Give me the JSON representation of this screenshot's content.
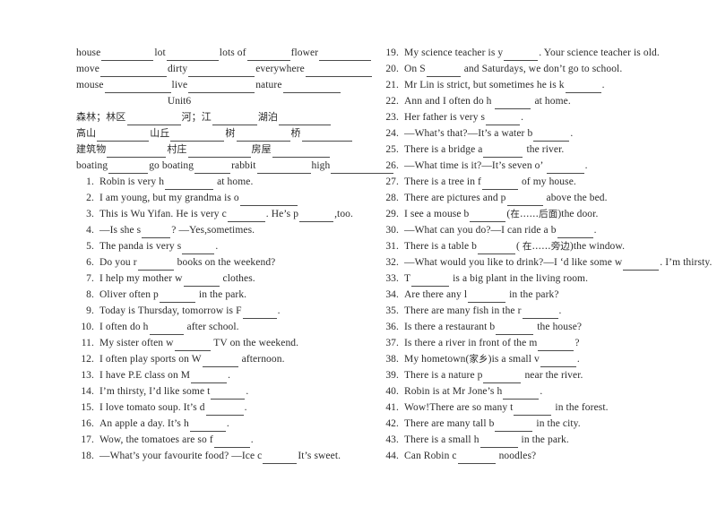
{
  "document": {
    "title": "Unit6 English Vocabulary and Fill-in-the-Blank Worksheet",
    "unit_heading": "Unit6"
  },
  "vocab_rows": [
    {
      "id": "vocab-row-1",
      "items": [
        {
          "word": "house",
          "blank": 58
        },
        {
          "word": "lot",
          "blank": 58
        },
        {
          "word": "lots of",
          "blank": 48
        },
        {
          "word": "flower",
          "blank": 58
        }
      ]
    },
    {
      "id": "vocab-row-2",
      "items": [
        {
          "word": "move",
          "blank": 74
        },
        {
          "word": "dirty",
          "blank": 74
        },
        {
          "word": "everywhere",
          "blank": 74
        }
      ]
    },
    {
      "id": "vocab-row-3",
      "items": [
        {
          "word": "mouse",
          "blank": 74
        },
        {
          "word": "live",
          "blank": 74
        },
        {
          "word": "nature",
          "blank": 64
        }
      ]
    },
    {
      "id": "vocab-row-4",
      "chinese": true,
      "items": [
        {
          "word": "森林；林区",
          "blank": 60
        },
        {
          "word": "河；江",
          "blank": 50
        },
        {
          "word": "湖泊",
          "blank": 58
        }
      ]
    },
    {
      "id": "vocab-row-5",
      "chinese": true,
      "items": [
        {
          "word": "高山",
          "blank": 58
        },
        {
          "word": "山丘",
          "blank": 60
        },
        {
          "word": "树",
          "blank": 60
        },
        {
          "word": "桥",
          "blank": 56
        }
      ]
    },
    {
      "id": "vocab-row-6",
      "chinese": true,
      "items": [
        {
          "word": "建筑物",
          "blank": 66
        },
        {
          "word": "村庄",
          "blank": 70
        },
        {
          "word": "房屋",
          "blank": 64
        }
      ]
    },
    {
      "id": "vocab-row-7",
      "items": [
        {
          "word": "boating",
          "blank": 44
        },
        {
          "word": "go boating",
          "blank": 40
        },
        {
          "word": "rabbit",
          "blank": 60
        },
        {
          "word": "high",
          "blank": 70
        }
      ]
    }
  ],
  "questions_left": [
    {
      "num": "1.",
      "pre": "Robin is very h",
      "blank": 54,
      "post": " at home."
    },
    {
      "num": "2.",
      "pre": "I am young, but my grandma is o",
      "blank": 64,
      "post": ""
    },
    {
      "num": "3.",
      "pre": "This is Wu Yifan. He is very c",
      "blank": 42,
      "post": ". He’s p",
      "blank2": 38,
      "post2": ",too."
    },
    {
      "num": "4.",
      "pre": "—Is she s",
      "blank": 32,
      "post": "?   —Yes,sometimes."
    },
    {
      "num": "5.",
      "pre": "The panda is very    s",
      "blank": 36,
      "post": "."
    },
    {
      "num": "6.",
      "pre": "Do you r",
      "blank": 40,
      "post": " books on the weekend?"
    },
    {
      "num": "7.",
      "pre": "I help my mother w",
      "blank": 40,
      "post": " clothes."
    },
    {
      "num": "8.",
      "pre": "Oliver often p",
      "blank": 40,
      "post": " in the park."
    },
    {
      "num": "9.",
      "pre": "Today is Thursday, tomorrow is F",
      "blank": 38,
      "post": "."
    },
    {
      "num": "10.",
      "pre": "I often do h",
      "blank": 38,
      "post": " after school."
    },
    {
      "num": "11.",
      "pre": "My sister often w",
      "blank": 40,
      "post": " TV on the weekend."
    },
    {
      "num": "12.",
      "pre": "I often play sports on W",
      "blank": 40,
      "post": " afternoon."
    },
    {
      "num": "13.",
      "pre": "I have P.E class on M",
      "blank": 40,
      "post": "."
    },
    {
      "num": "14.",
      "pre": "I’m thirsty, I’d like some t",
      "blank": 38,
      "post": "."
    },
    {
      "num": "15.",
      "pre": "I love tomato soup. It’s d",
      "blank": 42,
      "post": "."
    },
    {
      "num": "16.",
      "pre": " An apple a day. It’s h",
      "blank": 40,
      "post": "."
    },
    {
      "num": "17.",
      "pre": "Wow, the tomatoes are so f",
      "blank": 40,
      "post": "."
    },
    {
      "num": "18.",
      "pre": "—What’s your favourite food?   —Ice c",
      "blank": 38,
      "post": "It’s sweet."
    }
  ],
  "questions_right": [
    {
      "num": "19.",
      "pre": "My science teacher is y",
      "blank": 38,
      "post": ". Your science teacher is old."
    },
    {
      "num": "20.",
      "pre": "On S",
      "blank": 38,
      "post": " and Saturdays, we don’t go to school."
    },
    {
      "num": "21.",
      "pre": "Mr Lin is strict, but sometimes he is k",
      "blank": 40,
      "post": "."
    },
    {
      "num": "22.",
      "pre": "Ann and I often do h ",
      "blank": 40,
      "post": " at home."
    },
    {
      "num": "23.",
      "pre": "Her father is very s",
      "blank": 38,
      "post": "."
    },
    {
      "num": "24.",
      "pre": "—What’s that?—It’s a water b",
      "blank": 40,
      "post": "."
    },
    {
      "num": "25.",
      "pre": "There is a bridge a",
      "blank": 44,
      "post": " the river."
    },
    {
      "num": "26.",
      "pre": "—What time is it?—It’s seven o’ ",
      "blank": 42,
      "post": "."
    },
    {
      "num": "27.",
      "pre": "There is a tree in f",
      "blank": 40,
      "post": " of my house."
    },
    {
      "num": "28.",
      "pre": "There are pictures and p",
      "blank": 40,
      "post": " above the bed."
    },
    {
      "num": "29.",
      "pre": "I see a mouse b",
      "blank": 40,
      "post": "(",
      "cn": "在……后面",
      "post2": ")the door."
    },
    {
      "num": "30.",
      "pre": "—What can you do?—I can ride a b",
      "blank": 40,
      "post": "."
    },
    {
      "num": "31.",
      "pre": "There is a table b",
      "blank": 42,
      "post": "( ",
      "cn": "在……旁边",
      "post2": ")the window."
    },
    {
      "num": "32.",
      "pre": "—What would you like to drink?—I ‘d like some w",
      "blank": 40,
      "post": ". I’m thirsty."
    },
    {
      "num": "33.",
      "pre": "T",
      "blank": 42,
      "post": " is a big plant in the living room."
    },
    {
      "num": "34.",
      "pre": "Are there any l",
      "blank": 42,
      "post": " in the park?"
    },
    {
      "num": "35.",
      "pre": "There are many fish in the r",
      "blank": 40,
      "post": "."
    },
    {
      "num": "36.",
      "pre": "Is there a restaurant b",
      "blank": 42,
      "post": " the house?"
    },
    {
      "num": "37.",
      "pre": "Is there a river in front of the m",
      "blank": 40,
      "post": "?"
    },
    {
      "num": "38.",
      "pre": "My hometown(",
      "cnInline": "家乡",
      "mid": ")is a small v",
      "blank": 40,
      "post": "."
    },
    {
      "num": "39.",
      "pre": "There is a nature p",
      "blank": 42,
      "post": " near the river."
    },
    {
      "num": "40.",
      "pre": "Robin is at Mr Jone’s h",
      "blank": 40,
      "post": "."
    },
    {
      "num": "41.",
      "pre": "Wow!There are so many t",
      "blank": 42,
      "post": " in the forest."
    },
    {
      "num": "42.",
      "pre": "There are many tall b",
      "blank": 42,
      "post": " in the city."
    },
    {
      "num": "43.",
      "pre": "There is a small h",
      "blank": 42,
      "post": " in the park."
    },
    {
      "num": "44.",
      "pre": "Can Robin c",
      "blank": 42,
      "post": " noodles?"
    }
  ]
}
